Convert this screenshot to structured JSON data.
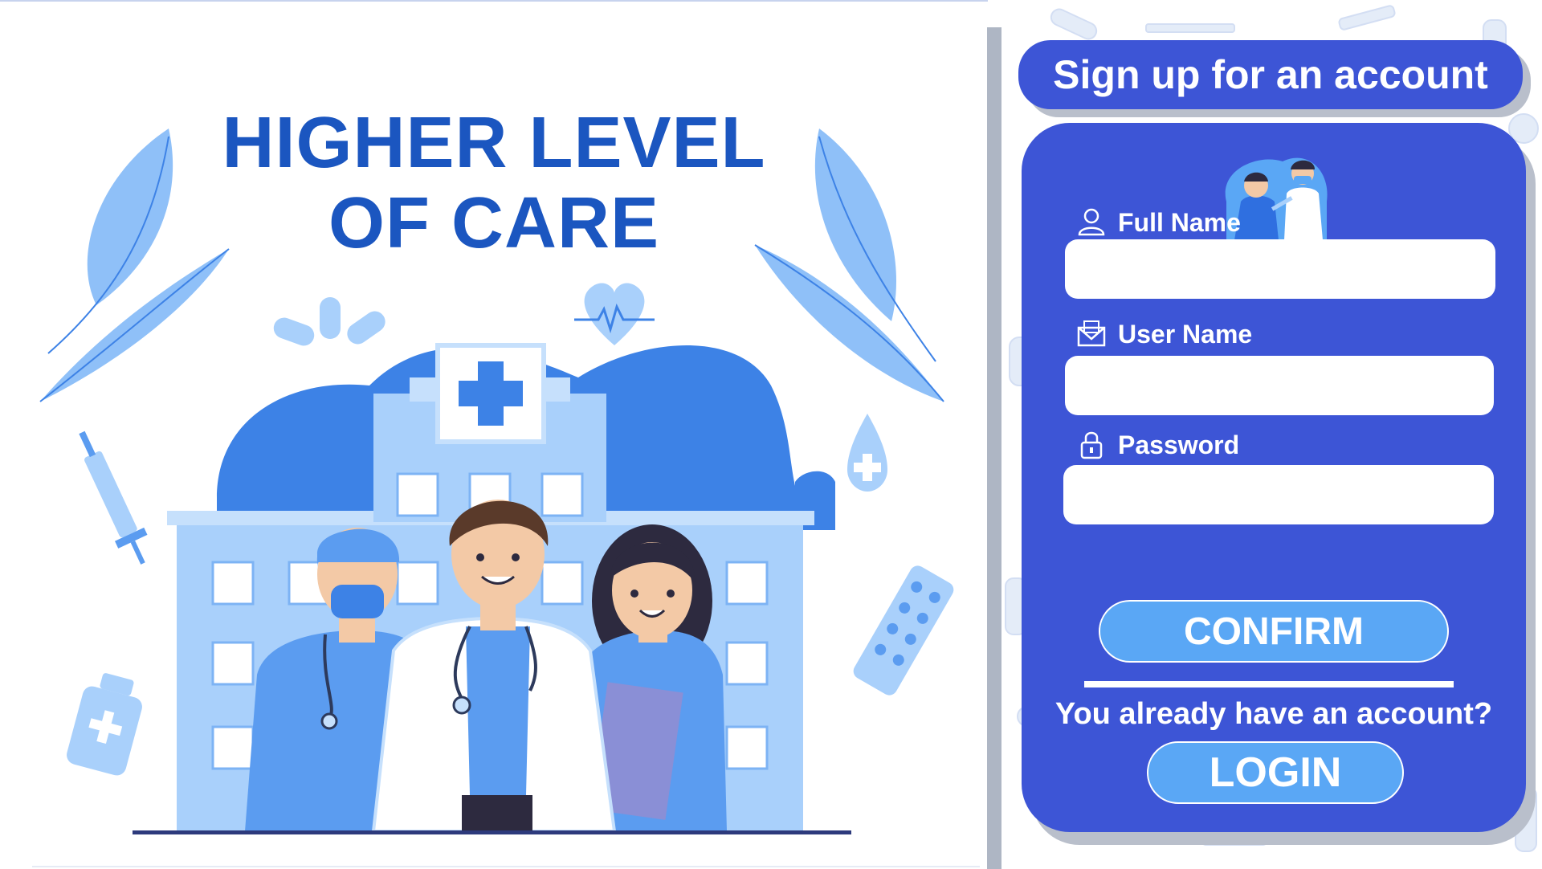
{
  "hero": {
    "title_line1": "HIGHER LEVEL",
    "title_line2": "OF CARE",
    "palette": {
      "title": "#1b56c0",
      "light": "#a9d0fb",
      "mid": "#5b9cf0",
      "dark": "#3d82e6"
    }
  },
  "signup": {
    "title": "Sign up for an account",
    "fields": [
      {
        "label": "Full Name",
        "icon": "user-icon",
        "value": "",
        "placeholder": ""
      },
      {
        "label": "User Name",
        "icon": "envelope-icon",
        "value": "",
        "placeholder": ""
      },
      {
        "label": "Password",
        "icon": "lock-icon",
        "value": "",
        "placeholder": ""
      }
    ],
    "confirm_label": "CONFIRM",
    "login_prompt": "You already have an account?",
    "login_label": "LOGIN",
    "colors": {
      "card": "#3d55d6",
      "button": "#5aa7f5",
      "shadow": "#b9bfcb"
    }
  }
}
